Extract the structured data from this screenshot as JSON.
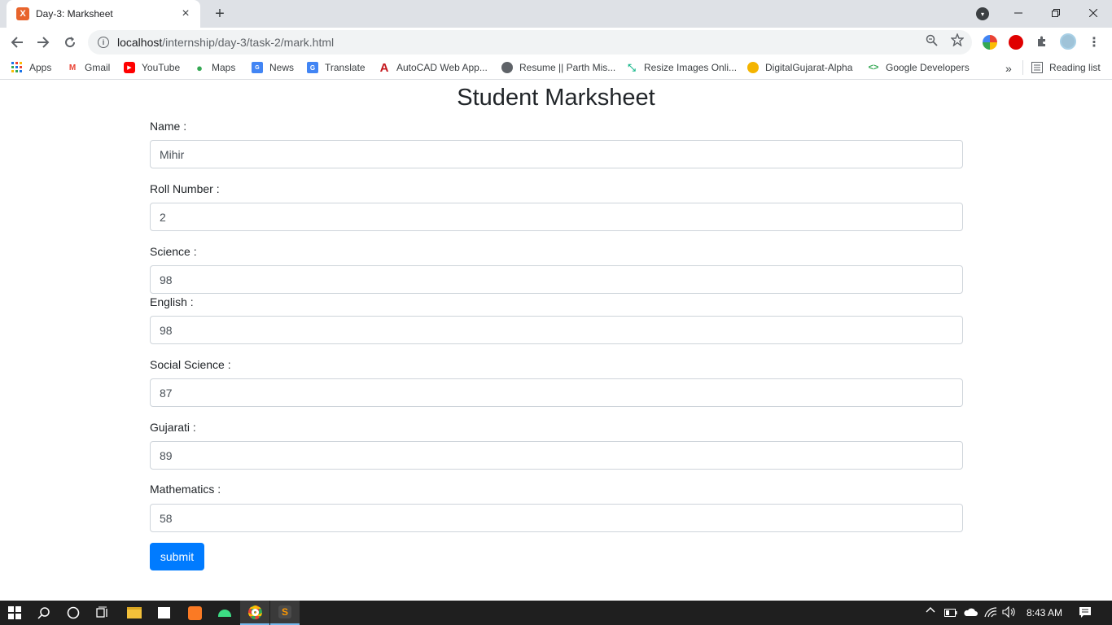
{
  "browser": {
    "tab_title": "Day-3: Marksheet",
    "favicon_text": "X",
    "new_tab": "+",
    "close_tab": "×",
    "url_host": "localhost",
    "url_path": "/internship/day-3/task-2/mark.html"
  },
  "bookmarks": [
    {
      "label": "Apps",
      "icon": "apps-grid-icon"
    },
    {
      "label": "Gmail",
      "icon": "gmail-icon"
    },
    {
      "label": "YouTube",
      "icon": "youtube-icon"
    },
    {
      "label": "Maps",
      "icon": "maps-icon"
    },
    {
      "label": "News",
      "icon": "news-icon"
    },
    {
      "label": "Translate",
      "icon": "translate-icon"
    },
    {
      "label": "AutoCAD Web App...",
      "icon": "autocad-icon"
    },
    {
      "label": "Resume || Parth Mis...",
      "icon": "globe-icon"
    },
    {
      "label": "Resize Images Onli...",
      "icon": "resize-icon"
    },
    {
      "label": "DigitalGujarat-Alpha",
      "icon": "digitalgujarat-icon"
    },
    {
      "label": "Google Developers",
      "icon": "google-developers-icon"
    }
  ],
  "reading_list": "Reading list",
  "more_bookmarks": "»",
  "page": {
    "heading": "Student Marksheet",
    "fields": [
      {
        "label": "Name :",
        "value": "Mihir"
      },
      {
        "label": "Roll Number :",
        "value": "2"
      },
      {
        "label": "Science :",
        "value": "98"
      },
      {
        "label": "English :",
        "value": "98"
      },
      {
        "label": "Social Science :",
        "value": "87"
      },
      {
        "label": "Gujarati :",
        "value": "89"
      },
      {
        "label": "Mathematics :",
        "value": "58"
      }
    ],
    "submit_label": "submit"
  },
  "taskbar": {
    "time": "8:43 AM"
  },
  "colors": {
    "primary_button": "#007bff",
    "tabstrip": "#dee1e6",
    "taskbar": "#1f1f1f"
  }
}
